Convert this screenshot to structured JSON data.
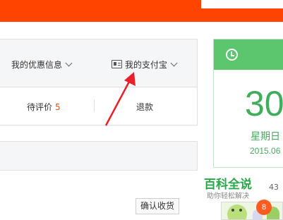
{
  "header": {
    "accent_color": "#ff4400"
  },
  "menu": {
    "promo_label": "我的优惠信息",
    "alipay_label": "我的支付宝",
    "alipay_icon": "id-card-icon"
  },
  "orders": {
    "pending_review_label": "待评价",
    "pending_review_count": "5",
    "refund_label": "退款",
    "confirm_receipt_label": "确认收货"
  },
  "calendar": {
    "icon": "clock-icon",
    "day": "30",
    "weekday": "星期日",
    "date": "2015.06",
    "accent_color": "#5cc66f"
  },
  "watermark": {
    "title": "百科全说",
    "subtitle": "助你轻松解决"
  },
  "side": {
    "partial_number": "43",
    "badge_count": "8"
  }
}
